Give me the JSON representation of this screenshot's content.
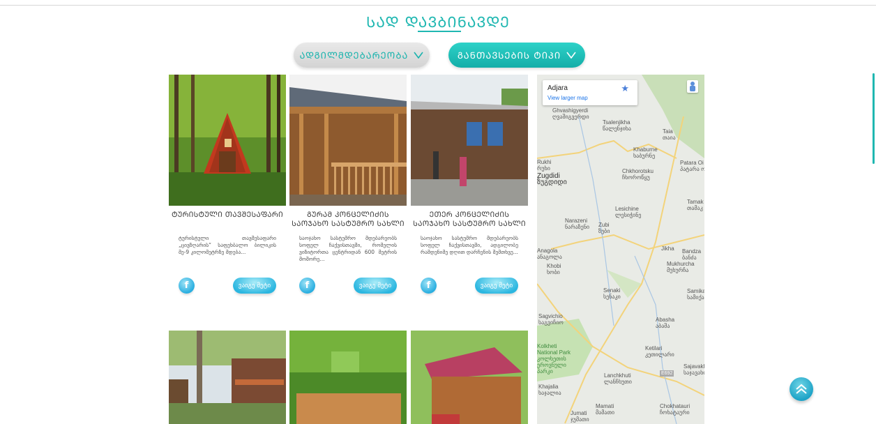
{
  "header": {
    "title": "ᲡᲐᲓ ᲓᲐᲕᲑᲘᲜᲐᲕᲓᲔ"
  },
  "filters": {
    "location_label": "ᲐᲓᲒᲘᲚᲛᲓᲔᲑᲐᲠᲔᲝᲑᲐ",
    "type_label": "ᲒᲐᲜᲗᲐᲕᲡᲔᲑᲘᲡ ᲢᲘᲞᲘ"
  },
  "cards": [
    {
      "title": "ᲢᲣᲠᲘᲡᲢᲣᲚᲘ ᲗᲐᲕᲨᲔᲡᲐᲤᲐᲠᲘ",
      "description": "ტურისტული თავშესაფარი „ცივზღარის“ საფეხბალო ბილიკის მე-9 კილომეტრზე მდება...",
      "more_label": "ვაიგე მეტი"
    },
    {
      "title": "ᲒᲣᲠᲐᲛ ᲙᲝᲜᲪᲔᲚᲘᲫᲘᲡ ᲡᲐᲝᲯᲐᲮᲝ ᲡᲐᲡᲢᲣᲛᲠᲝ ᲡᲐᲮᲚᲘ",
      "description": "საოჯახო სასტუმრო მდებარეობს სოფელ ჩაქვისთავში, რომელის ვიზიტორთა ცენტრიდან 600 მეტრის მოშორე...",
      "more_label": "ვაიგე მეტი"
    },
    {
      "title": "ᲔᲗᲔᲠ ᲙᲝᲜᲪᲔᲚᲘᲫᲘᲡ ᲡᲐᲝᲯᲐᲮᲝ ᲡᲐᲡᲢᲣᲛᲠᲝ ᲡᲐᲮᲚᲘ",
      "description": "საოჯახო სასტუმრო მდებარეობს სოფელ ჩაქვისთავში, ადგილობე რამდენიმე დღით დარჩენის შემთხვე...",
      "more_label": "ვაიგე მეტი"
    },
    {
      "title": "",
      "description": "",
      "more_label": ""
    },
    {
      "title": "",
      "description": "",
      "more_label": ""
    },
    {
      "title": "",
      "description": "",
      "more_label": ""
    }
  ],
  "map": {
    "region_name": "Adjara",
    "view_larger_label": "View larger map",
    "places": [
      {
        "name": "Ghvashigyerdi",
        "local": "ღვაშიგვერდი"
      },
      {
        "name": "Tsalenjikha",
        "local": "წალენჯიხა"
      },
      {
        "name": "Taia",
        "local": "თაია"
      },
      {
        "name": "Khaburne",
        "local": "ხაბურნე"
      },
      {
        "name": "Patara Oi",
        "local": "პატარა ოი"
      },
      {
        "name": "Rukhi",
        "local": "რუხი"
      },
      {
        "name": "Chkhorotsku",
        "local": "ჩხოროწყუ"
      },
      {
        "name": "Zugdidi",
        "local": "ზუგდიდი"
      },
      {
        "name": "Tamak",
        "local": "თამაკ"
      },
      {
        "name": "Lesichine",
        "local": "ლესიჭინე"
      },
      {
        "name": "Narazeni",
        "local": "ნარაზენი"
      },
      {
        "name": "Zubi",
        "local": "ზუბი"
      },
      {
        "name": "Anagola",
        "local": "ანაგოლა"
      },
      {
        "name": "Jikha",
        "local": "ჯიხა"
      },
      {
        "name": "Bandza",
        "local": "ბანძა"
      },
      {
        "name": "Khobi",
        "local": "ხობი"
      },
      {
        "name": "Mukhurcha",
        "local": "მუხურჩა"
      },
      {
        "name": "Senaki",
        "local": "სენაკი"
      },
      {
        "name": "Samikao",
        "local": "სამიქაო"
      },
      {
        "name": "Sagvichio",
        "local": "საგვიჩიო"
      },
      {
        "name": "Abasha",
        "local": "აბაშა"
      },
      {
        "name": "Kolkheti National Park",
        "local": "კოლხეთის ეროვნული პარკი"
      },
      {
        "name": "Ketilari",
        "local": "კეთილარი"
      },
      {
        "name": "Sajavakho",
        "local": "საჯავახო"
      },
      {
        "name": "Lanchkhuti",
        "local": "ლანჩხუთი"
      },
      {
        "name": "Khajalia",
        "local": "ხაჯალია"
      },
      {
        "name": "Jumati",
        "local": "ჯუმათი"
      },
      {
        "name": "Mamati",
        "local": "მამათი"
      },
      {
        "name": "Chokhatauri",
        "local": "ჩოხატაური"
      }
    ],
    "road_label": "E692"
  },
  "colors": {
    "accent": "#1fb7b1",
    "button_active": "#1aaea8",
    "button_inactive": "#dcdcdc",
    "title_text": "#3b3b3b"
  }
}
